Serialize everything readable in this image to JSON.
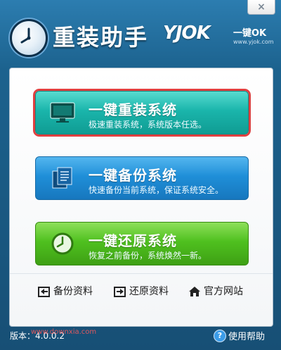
{
  "window": {
    "close_label": "×"
  },
  "header": {
    "title": "重装助手",
    "brand_logo": "YJOK",
    "brand_tag": "一键OK",
    "brand_url": "www.yjok.com"
  },
  "actions": [
    {
      "title": "一键重装系统",
      "desc": "极速重装系统，系统版本任选。",
      "icon": "monitor-icon"
    },
    {
      "title": "一键备份系统",
      "desc": "快速备份当前系统，保证系统安全。",
      "icon": "document-icon"
    },
    {
      "title": "一键还原系统",
      "desc": "恢复之前备份，系统焕然一新。",
      "icon": "clock-icon"
    }
  ],
  "links": [
    {
      "label": "备份资料",
      "icon": "backup-icon"
    },
    {
      "label": "还原资料",
      "icon": "restore-icon"
    },
    {
      "label": "官方网站",
      "icon": "home-icon"
    }
  ],
  "footer": {
    "version": "版本：4.0.0.2",
    "watermark_url": "www.downxia.com",
    "help_label": "使用帮助",
    "help_icon_glyph": "?"
  },
  "colors": {
    "reinstall": "#1ab5ab",
    "backup": "#1f8fd8",
    "restore": "#4fc01f",
    "highlight": "#e04040"
  }
}
